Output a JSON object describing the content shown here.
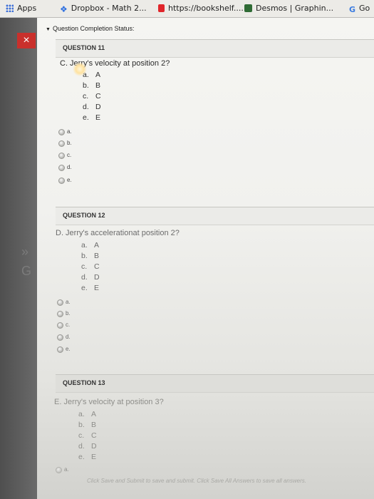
{
  "bookmarks": [
    {
      "label": "Apps",
      "icon": "apps-grid-icon"
    },
    {
      "label": "Dropbox - Math 2...",
      "icon": "dropbox-icon"
    },
    {
      "label": "https://bookshelf....",
      "icon": "bookshelf-icon"
    },
    {
      "label": "Desmos | Graphin...",
      "icon": "desmos-icon"
    },
    {
      "label": "Go",
      "icon": "google-icon"
    }
  ],
  "completion_status": "Question Completion Status:",
  "close_label": "×",
  "questions": [
    {
      "header": "QUESTION 11",
      "text": "C. Jerry's velocity at position 2?",
      "options": [
        {
          "letter": "a.",
          "value": "A"
        },
        {
          "letter": "b.",
          "value": "B"
        },
        {
          "letter": "c.",
          "value": "C"
        },
        {
          "letter": "d.",
          "value": "D"
        },
        {
          "letter": "e.",
          "value": "E"
        }
      ],
      "radios": [
        "a.",
        "b.",
        "c.",
        "d.",
        "e."
      ]
    },
    {
      "header": "QUESTION 12",
      "text": "D. Jerry's accelerationat position 2?",
      "options": [
        {
          "letter": "a.",
          "value": "A"
        },
        {
          "letter": "b.",
          "value": "B"
        },
        {
          "letter": "c.",
          "value": "C"
        },
        {
          "letter": "d.",
          "value": "D"
        },
        {
          "letter": "e.",
          "value": "E"
        }
      ],
      "radios": [
        "a.",
        "b.",
        "c.",
        "d.",
        "e."
      ]
    },
    {
      "header": "QUESTION 13",
      "text": "E. Jerry's velocity at position 3?",
      "options": [
        {
          "letter": "a.",
          "value": "A"
        },
        {
          "letter": "b.",
          "value": "B"
        },
        {
          "letter": "c.",
          "value": "C"
        },
        {
          "letter": "d.",
          "value": "D"
        },
        {
          "letter": "e.",
          "value": "E"
        }
      ],
      "radios": [
        "a."
      ]
    }
  ],
  "footer": "Click Save and Submit to save and submit. Click Save All Answers to save all answers."
}
